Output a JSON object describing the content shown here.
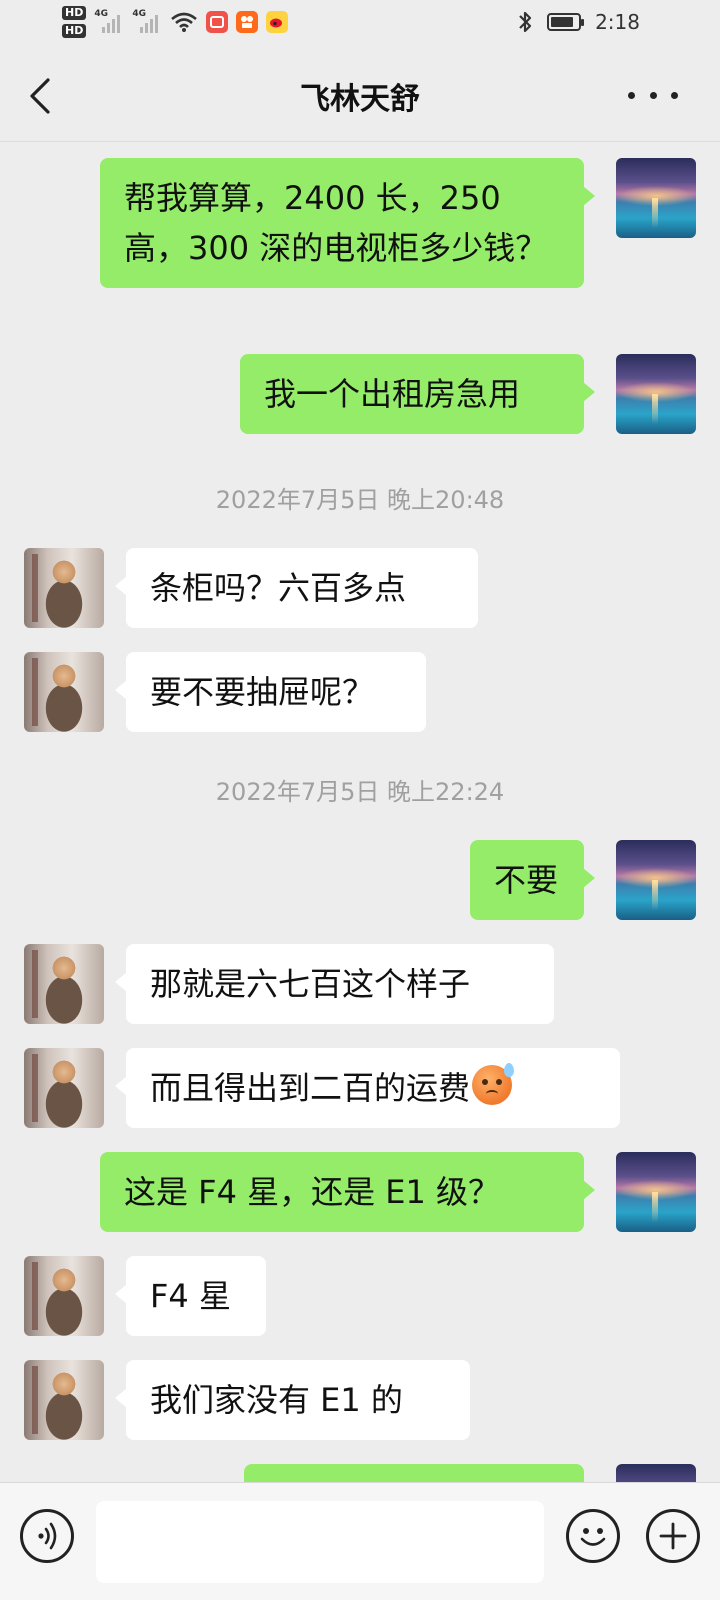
{
  "status_bar": {
    "hd1": "HD",
    "hd2": "HD",
    "signal1": "4G",
    "signal2": "4G",
    "time": "2:18",
    "icons": [
      "wifi-icon",
      "notification-app-icon",
      "kuaishou-app-icon",
      "weibo-app-icon",
      "bluetooth-icon",
      "battery-icon"
    ]
  },
  "header": {
    "title": "飞林天舒",
    "back_icon": "chevron-left-icon",
    "more_icon": "more-dots-icon"
  },
  "messages": [
    {
      "side": "mine",
      "text": "帮我算算，2400 长，250 高，300 深的电视柜多少钱？"
    },
    {
      "side": "mine",
      "text": "我一个出租房急用"
    },
    {
      "type": "time",
      "text": "2022年7月5日 晚上20:48"
    },
    {
      "side": "peer",
      "text": "条柜吗？六百多点"
    },
    {
      "side": "peer",
      "text": "要不要抽屉呢？"
    },
    {
      "type": "time",
      "text": "2022年7月5日 晚上22:24"
    },
    {
      "side": "mine",
      "text": "不要"
    },
    {
      "side": "peer",
      "text": "那就是六七百这个样子"
    },
    {
      "side": "peer",
      "text": "而且得出到二百的运费",
      "emoji": "sweat-face-emoji"
    },
    {
      "side": "mine",
      "text": "这是 F4 星，还是 E1 级？"
    },
    {
      "side": "peer",
      "text": "F4 星"
    },
    {
      "side": "peer",
      "text": "我们家没有 E1 的"
    },
    {
      "side": "mine",
      "text": ""
    }
  ],
  "input_bar": {
    "voice_icon": "voice-icon",
    "emoji_icon": "smiley-icon",
    "plus_icon": "plus-icon",
    "value": ""
  },
  "colors": {
    "background": "#ededed",
    "mine_bubble": "#95ec69",
    "peer_bubble": "#ffffff",
    "timestamp": "#a0a0a0"
  }
}
